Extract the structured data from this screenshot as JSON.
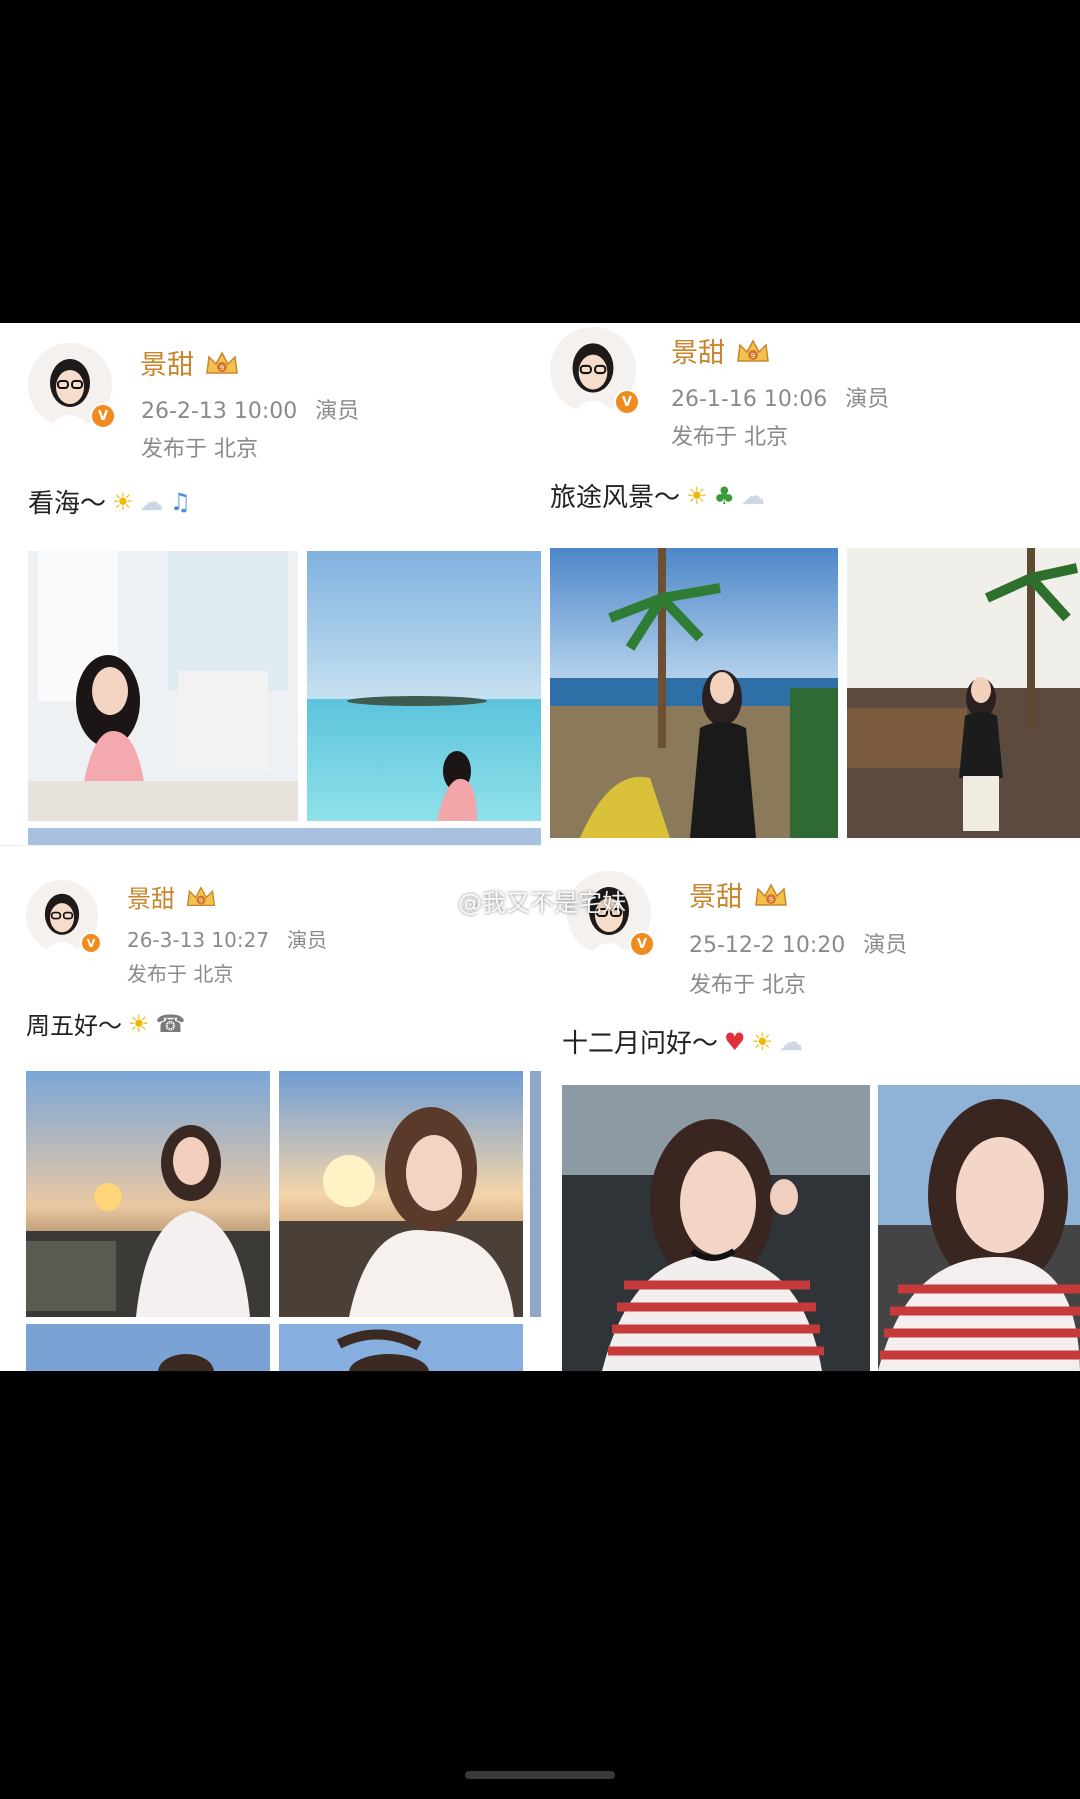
{
  "posts": [
    {
      "username": "景甜",
      "date": "26-2-13 10:00",
      "role": "演员",
      "location": "发布于 北京",
      "caption": "看海～",
      "emojis": [
        "sun-emoji",
        "cloud-emoji",
        "music-note-emoji"
      ]
    },
    {
      "username": "景甜",
      "date": "26-1-16 10:06",
      "role": "演员",
      "location": "发布于 北京",
      "caption": "旅途风景～",
      "emojis": [
        "sun-emoji",
        "palm-tree-emoji",
        "cloud-emoji"
      ]
    },
    {
      "username": "景甜",
      "date": "26-3-13 10:27",
      "role": "演员",
      "location": "发布于 北京",
      "caption": "周五好～",
      "emojis": [
        "sun-emoji",
        "phone-emoji"
      ]
    },
    {
      "username": "景甜",
      "date": "25-12-2 10:20",
      "role": "演员",
      "location": "发布于 北京",
      "caption": "十二月问好～",
      "emojis": [
        "heart-emoji",
        "sun-emoji",
        "cloud-emoji"
      ]
    }
  ],
  "verified_badge": "V",
  "watermark": "@我又不是宅妹",
  "colors": {
    "username": "#c8852c",
    "meta": "#8a8a8a",
    "badge": "#f08c1d",
    "background": "#000000"
  }
}
